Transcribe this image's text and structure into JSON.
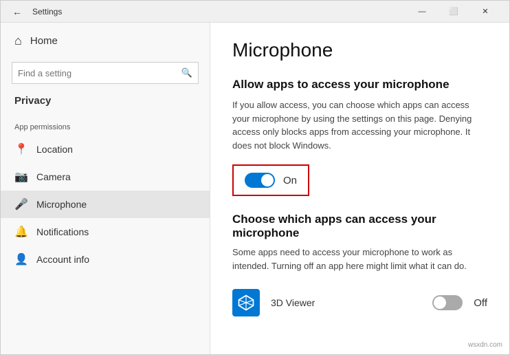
{
  "window": {
    "title": "Settings",
    "controls": {
      "minimize": "—",
      "maximize": "⬜",
      "close": "✕"
    }
  },
  "sidebar": {
    "back_icon": "←",
    "home_label": "Home",
    "home_icon": "⌂",
    "search_placeholder": "Find a setting",
    "search_icon": "🔍",
    "privacy_label": "Privacy",
    "app_permissions_label": "App permissions",
    "items": [
      {
        "id": "location",
        "label": "Location",
        "icon": "📍"
      },
      {
        "id": "camera",
        "label": "Camera",
        "icon": "📷"
      },
      {
        "id": "microphone",
        "label": "Microphone",
        "icon": "🎤",
        "active": true
      },
      {
        "id": "notifications",
        "label": "Notifications",
        "icon": "🔔"
      },
      {
        "id": "account-info",
        "label": "Account info",
        "icon": "👤"
      }
    ]
  },
  "content": {
    "title": "Microphone",
    "section1": {
      "heading": "Allow apps to access your microphone",
      "description": "If you allow access, you can choose which apps can access your microphone by using the settings on this page. Denying access only blocks apps from accessing your microphone. It does not block Windows."
    },
    "toggle": {
      "state": "on",
      "label": "On"
    },
    "section2": {
      "heading": "Choose which apps can access your microphone",
      "description": "Some apps need to access your microphone to work as intended. Turning off an app here might limit what it can do."
    },
    "apps": [
      {
        "name": "3D Viewer",
        "toggle_state": "off",
        "toggle_label": "Off"
      }
    ]
  },
  "watermark": "wsxdn.com"
}
